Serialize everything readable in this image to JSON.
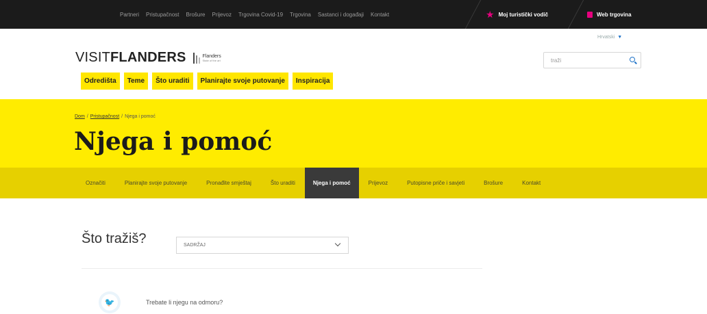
{
  "topbar": {
    "links": [
      "Partneri",
      "Pristupačnost",
      "Brošure",
      "Prijevoz",
      "Trgovina Covid-19",
      "Trgovina",
      "Sastanci i događaji",
      "Kontakt"
    ],
    "my_guide": "Moj turistički vodič",
    "web_shop": "Web trgovina"
  },
  "language": {
    "selected": "Hrvatski"
  },
  "logo": {
    "part1": "VISIT",
    "part2": "FLANDERS",
    "partner": "Flanders",
    "tagline": "State of the art"
  },
  "search": {
    "placeholder": "traži"
  },
  "main_nav": [
    "Odredišta",
    "Teme",
    "Što uraditi",
    "Planirajte svoje putovanje",
    "Inspiracija"
  ],
  "breadcrumb": {
    "home": "Dom",
    "section": "Pristupačnost",
    "current": "Njega i pomoć"
  },
  "page_title": "Njega i pomoć",
  "sub_nav": {
    "items": [
      "Označiti",
      "Planirajte svoje putovanje",
      "Pronađite smještaj",
      "Što uraditi",
      "Njega i pomoć",
      "Prijevoz",
      "Putopisne priče i savjeti",
      "Brošure",
      "Kontakt"
    ],
    "active_index": 4
  },
  "filter": {
    "question": "Što tražiš?",
    "select_value": "SADRŽAJ"
  },
  "results": [
    {
      "text": "Trebate li njegu na odmoru?"
    }
  ],
  "colors": {
    "yellow": "#ffec00",
    "subnav": "#e6d000",
    "button": "#ffe600",
    "accent_pink": "#e6007e",
    "link_blue": "#1f73c8"
  }
}
